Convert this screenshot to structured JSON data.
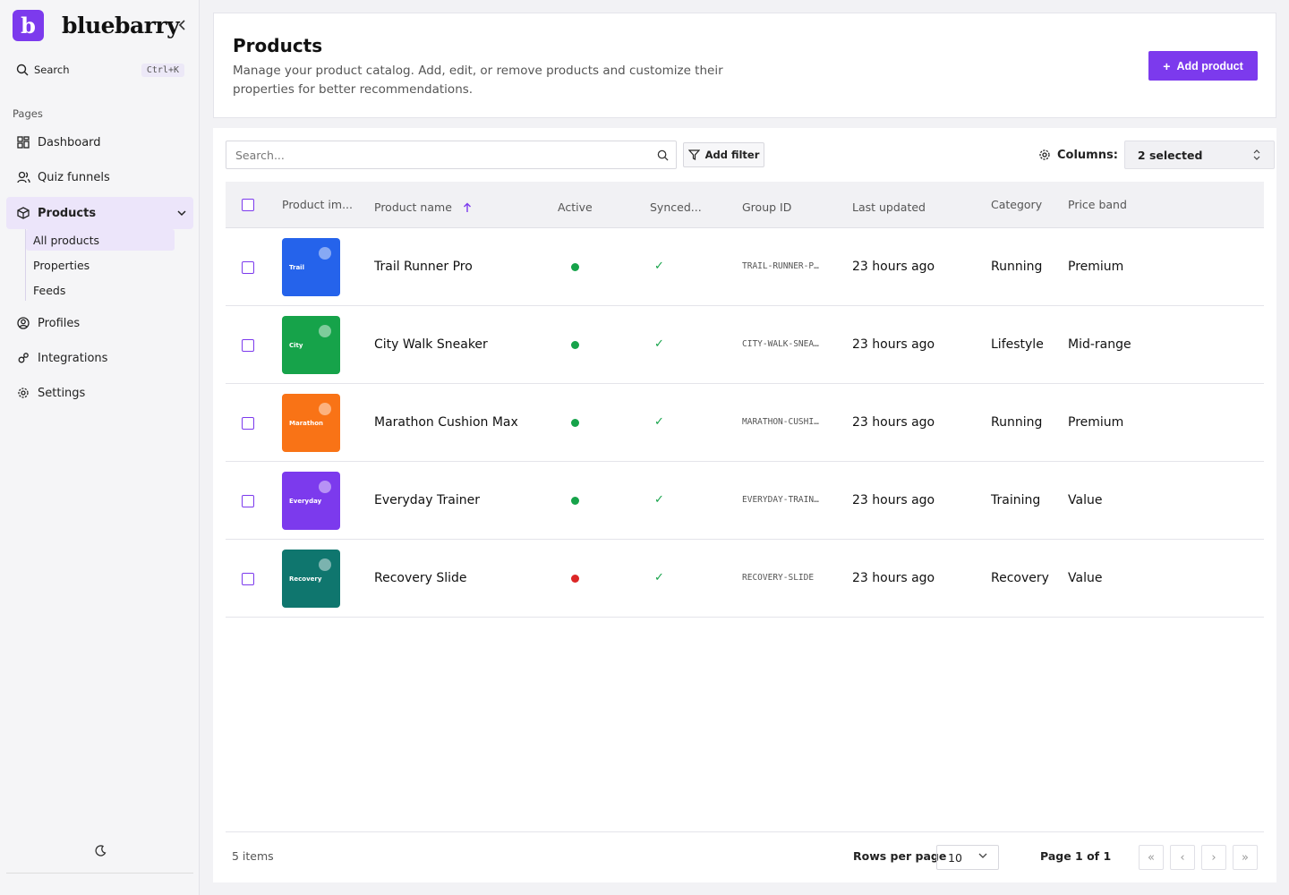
{
  "app": {
    "logo_letter": "b",
    "name": "bluebarry"
  },
  "sidebar": {
    "search_label": "Search",
    "search_shortcut": "Ctrl+K",
    "section_label": "Pages",
    "items": [
      {
        "label": "Dashboard",
        "icon": "dashboard-icon"
      },
      {
        "label": "Quiz funnels",
        "icon": "users-icon"
      },
      {
        "label": "Products",
        "icon": "box-icon",
        "active": true,
        "expanded": true
      },
      {
        "label": "Profiles",
        "icon": "user-circle-icon"
      },
      {
        "label": "Integrations",
        "icon": "integration-icon"
      },
      {
        "label": "Settings",
        "icon": "gear-icon"
      }
    ],
    "products_subitems": [
      {
        "label": "All products",
        "active": true
      },
      {
        "label": "Properties"
      },
      {
        "label": "Feeds"
      }
    ]
  },
  "header": {
    "title": "Products",
    "description": "Manage your product catalog. Add, edit, or remove products and customize their properties for better recommendations.",
    "add_button": "Add product"
  },
  "toolbar": {
    "search_placeholder": "Search...",
    "filter_button": "Add filter",
    "columns_label": "Columns:",
    "columns_value": "2 selected"
  },
  "table": {
    "columns": [
      "Product im...",
      "Product name",
      "Active",
      "Synced...",
      "Group ID",
      "Last updated",
      "Category",
      "Price band"
    ],
    "sort": {
      "column": "Product name",
      "direction": "ascending"
    },
    "rows": [
      {
        "image_label": "Trail",
        "image_color": "#2563eb",
        "name": "Trail Runner Pro",
        "active": true,
        "synced": "✓",
        "group_id": "TRAIL-RUNNER-P…",
        "last_updated": "23 hours ago",
        "category": "Running",
        "price_band": "Premium"
      },
      {
        "image_label": "City",
        "image_color": "#16a34a",
        "name": "City Walk Sneaker",
        "active": true,
        "synced": "✓",
        "group_id": "CITY-WALK-SNEA…",
        "last_updated": "23 hours ago",
        "category": "Lifestyle",
        "price_band": "Mid-range"
      },
      {
        "image_label": "Marathon",
        "image_color": "#f97316",
        "name": "Marathon Cushion Max",
        "active": true,
        "synced": "✓",
        "group_id": "MARATHON-CUSHI…",
        "last_updated": "23 hours ago",
        "category": "Running",
        "price_band": "Premium"
      },
      {
        "image_label": "Everyday",
        "image_color": "#7c3aed",
        "name": "Everyday Trainer",
        "active": true,
        "synced": "✓",
        "group_id": "EVERYDAY-TRAIN…",
        "last_updated": "23 hours ago",
        "category": "Training",
        "price_band": "Value"
      },
      {
        "image_label": "Recovery",
        "image_color": "#0f766e",
        "name": "Recovery Slide",
        "active": false,
        "synced": "✓",
        "group_id": "RECOVERY-SLIDE",
        "last_updated": "23 hours ago",
        "category": "Recovery",
        "price_band": "Value"
      }
    ]
  },
  "footer": {
    "items_count": "5 items",
    "rows_per_page_label": "Rows per page",
    "rows_per_page_value": "10",
    "page_info": "Page 1 of 1"
  },
  "colors": {
    "accent": "#7c3aed",
    "active_dot": "#16a34a",
    "inactive_dot": "#dc2626",
    "synced_check": "#16a34a"
  }
}
